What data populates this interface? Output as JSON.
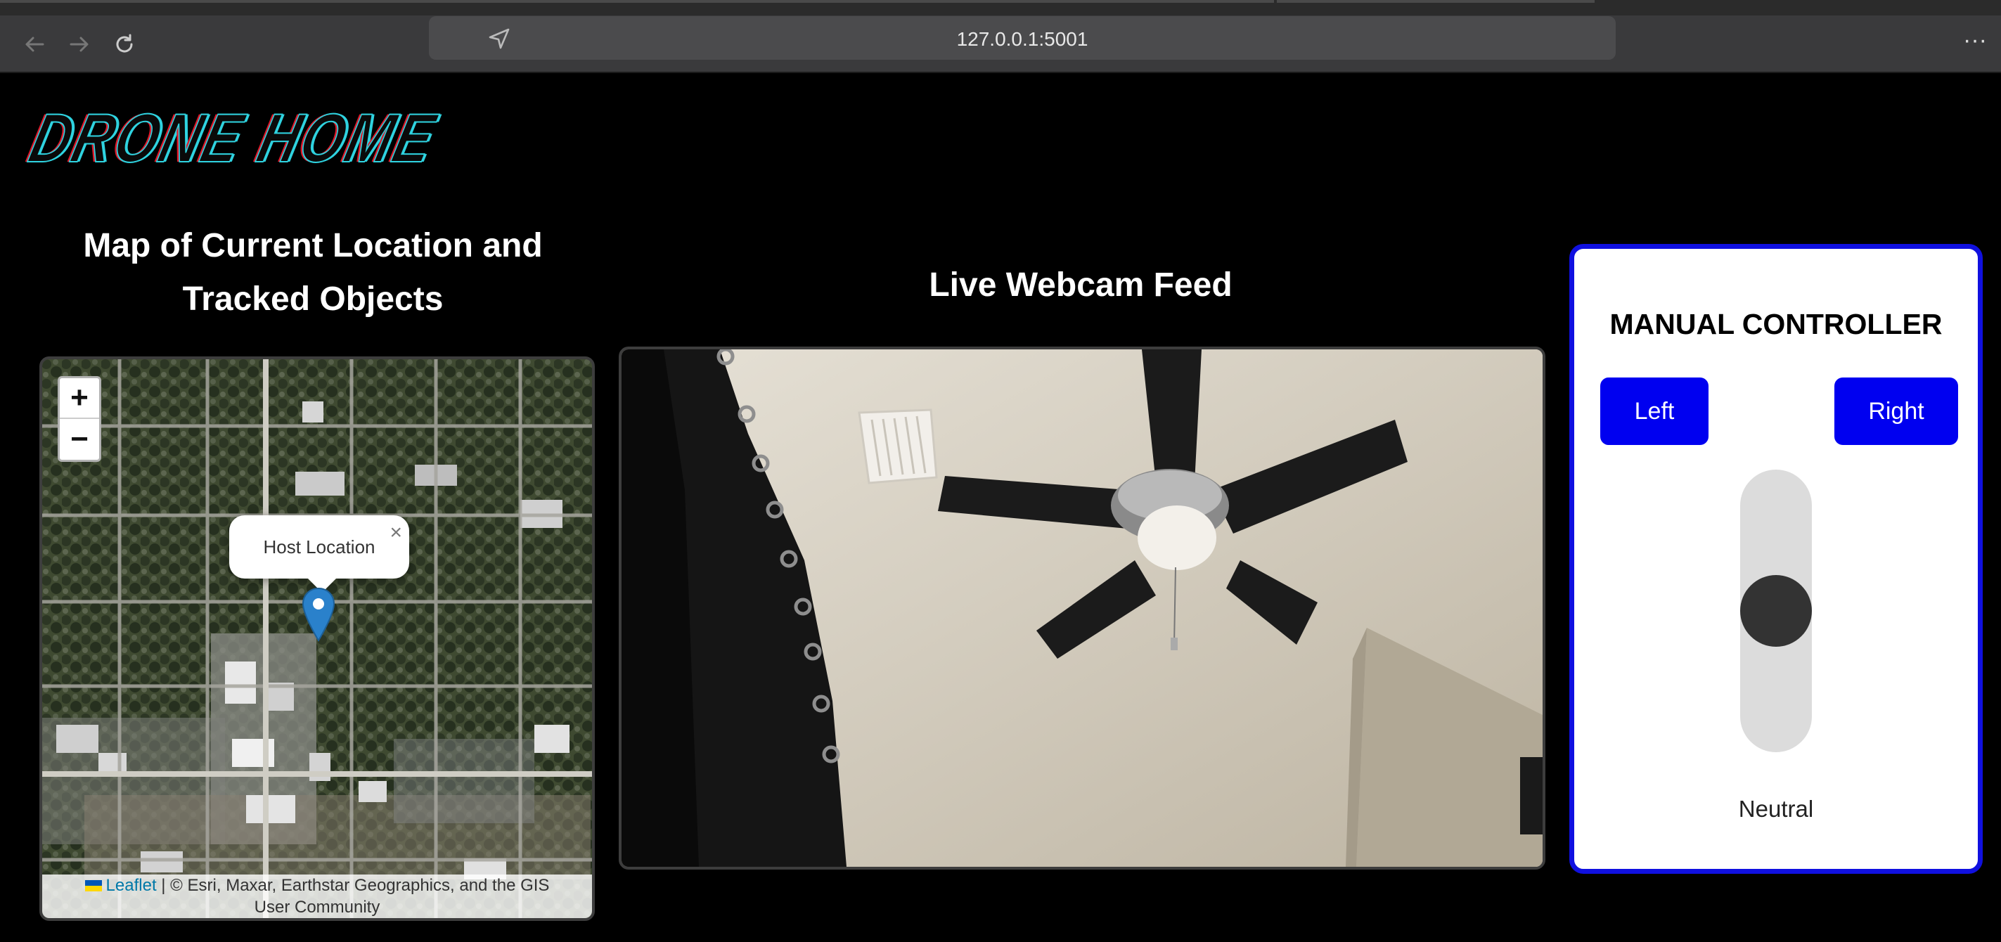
{
  "browser": {
    "url": "127.0.0.1:5001",
    "back_icon": "arrow-left-icon",
    "forward_icon": "arrow-right-icon",
    "reload_icon": "reload-icon",
    "location_icon": "location-arrow-icon",
    "more_icon": "more-dots-icon"
  },
  "header": {
    "logo_text": "DRONE HOME"
  },
  "map_section": {
    "title": "Map of Current Location and Tracked Objects",
    "zoom_in": "+",
    "zoom_out": "−",
    "popup_text": "Host Location",
    "popup_close": "×",
    "attribution_link": "Leaflet",
    "attribution_text": " | © Esri, Maxar, Earthstar Geographics, and the GIS User Community"
  },
  "feed_section": {
    "title": "Live Webcam Feed"
  },
  "controller": {
    "title": "MANUAL CONTROLLER",
    "left_label": "Left",
    "right_label": "Right",
    "status": "Neutral",
    "throttle_level": 0.5
  },
  "colors": {
    "page_bg": "#000000",
    "controller_border": "#1010e0",
    "button_bg": "#0000f0",
    "marker": "#2a81cb",
    "logo_red": "#e0192a",
    "logo_cyan": "#2fd3e0"
  }
}
